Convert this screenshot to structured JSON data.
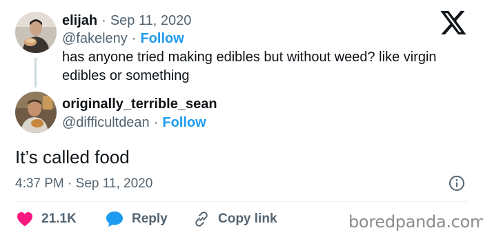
{
  "tweet": {
    "author": {
      "name": "elijah",
      "date": "Sep 11, 2020",
      "handle": "@fakeleny",
      "follow_label": "Follow"
    },
    "text": "has anyone tried making edibles but without weed? like virgin edibles or something"
  },
  "reply": {
    "author": {
      "name": "originally_terrible_sean",
      "handle": "@difficultdean",
      "follow_label": "Follow"
    },
    "text": "It’s called food",
    "timestamp": "4:37 PM · Sep 11, 2020"
  },
  "actions": {
    "like_count": "21.1K",
    "reply_label": "Reply",
    "copy_link_label": "Copy link"
  },
  "watermark": "boredpanda.com",
  "separator": "·",
  "colors": {
    "follow": "#1d9bf0",
    "like": "#f91880",
    "reply_icon": "#1d9bf0",
    "muted": "#536471"
  },
  "icons": [
    "x-logo-icon",
    "info-icon",
    "heart-icon",
    "reply-bubble-icon",
    "link-icon"
  ]
}
